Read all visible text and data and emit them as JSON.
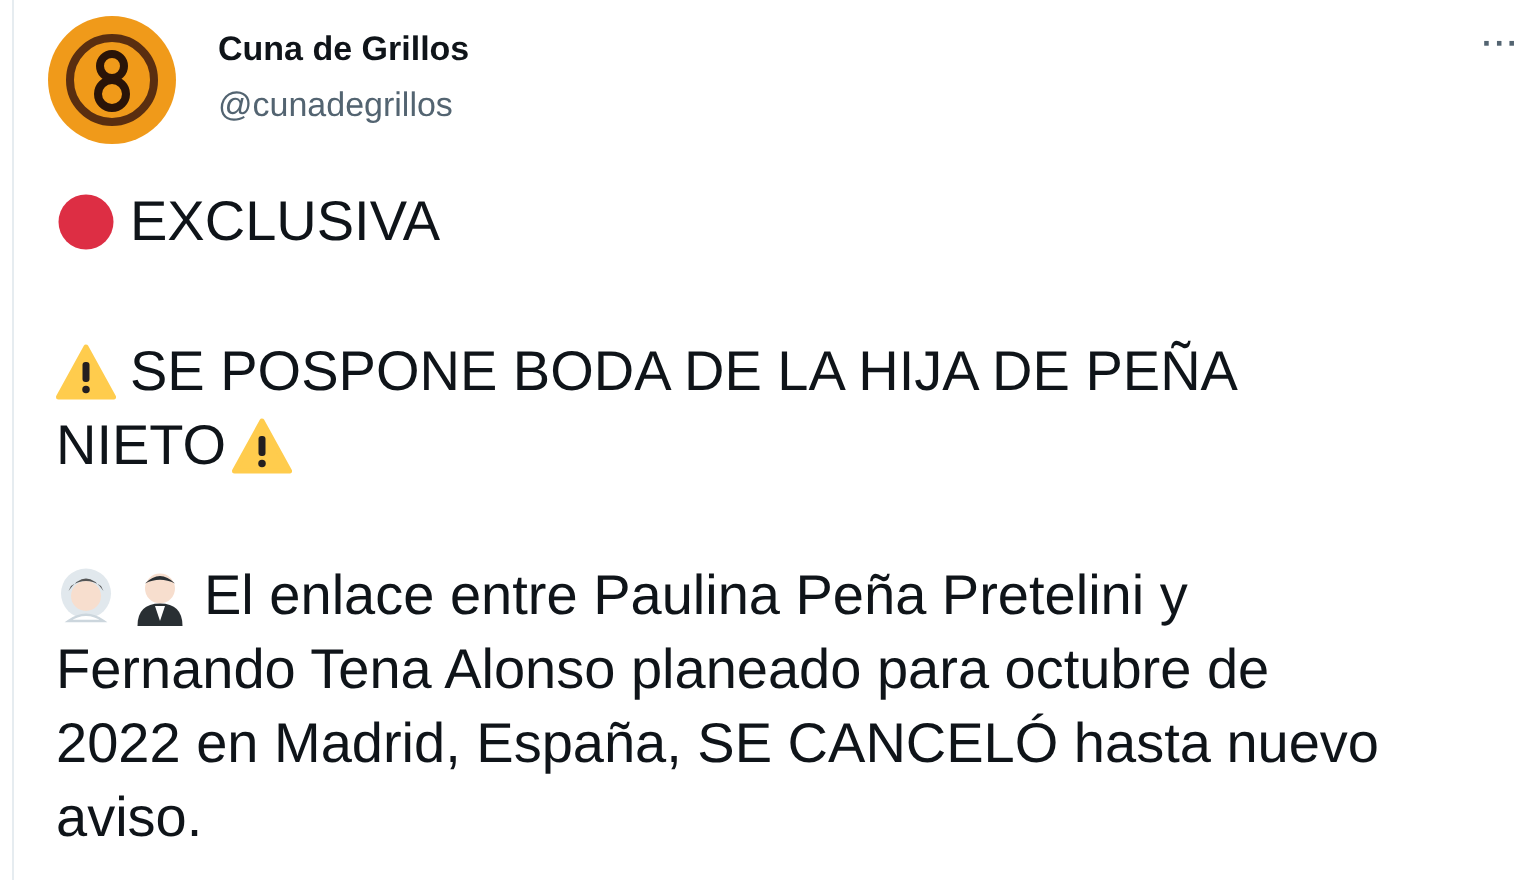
{
  "author": {
    "name": "Cuna de Grillos",
    "handle": "@cunadegrillos"
  },
  "menu": {
    "label": "···"
  },
  "paragraphs": [
    [
      [
        {
          "kind": "dot"
        },
        {
          "kind": "text",
          "text": "EXCLUSIVA"
        }
      ]
    ],
    [
      [
        {
          "kind": "warning"
        },
        {
          "kind": "text",
          "text": "SE POSPONE BODA DE LA HIJA DE PEÑA"
        }
      ],
      [
        {
          "kind": "text",
          "text": "NIETO"
        },
        {
          "kind": "warning"
        }
      ]
    ],
    [
      [
        {
          "kind": "bride"
        },
        {
          "kind": "groom"
        },
        {
          "kind": "text",
          "text": "El enlace entre Paulina Peña Pretelini y"
        }
      ],
      [
        {
          "kind": "text",
          "text": "Fernando Tena Alonso planeado para octubre de"
        }
      ],
      [
        {
          "kind": "text",
          "text": "2022 en Madrid, España, SE CANCELÓ hasta nuevo"
        }
      ],
      [
        {
          "kind": "text",
          "text": "aviso."
        }
      ]
    ]
  ]
}
